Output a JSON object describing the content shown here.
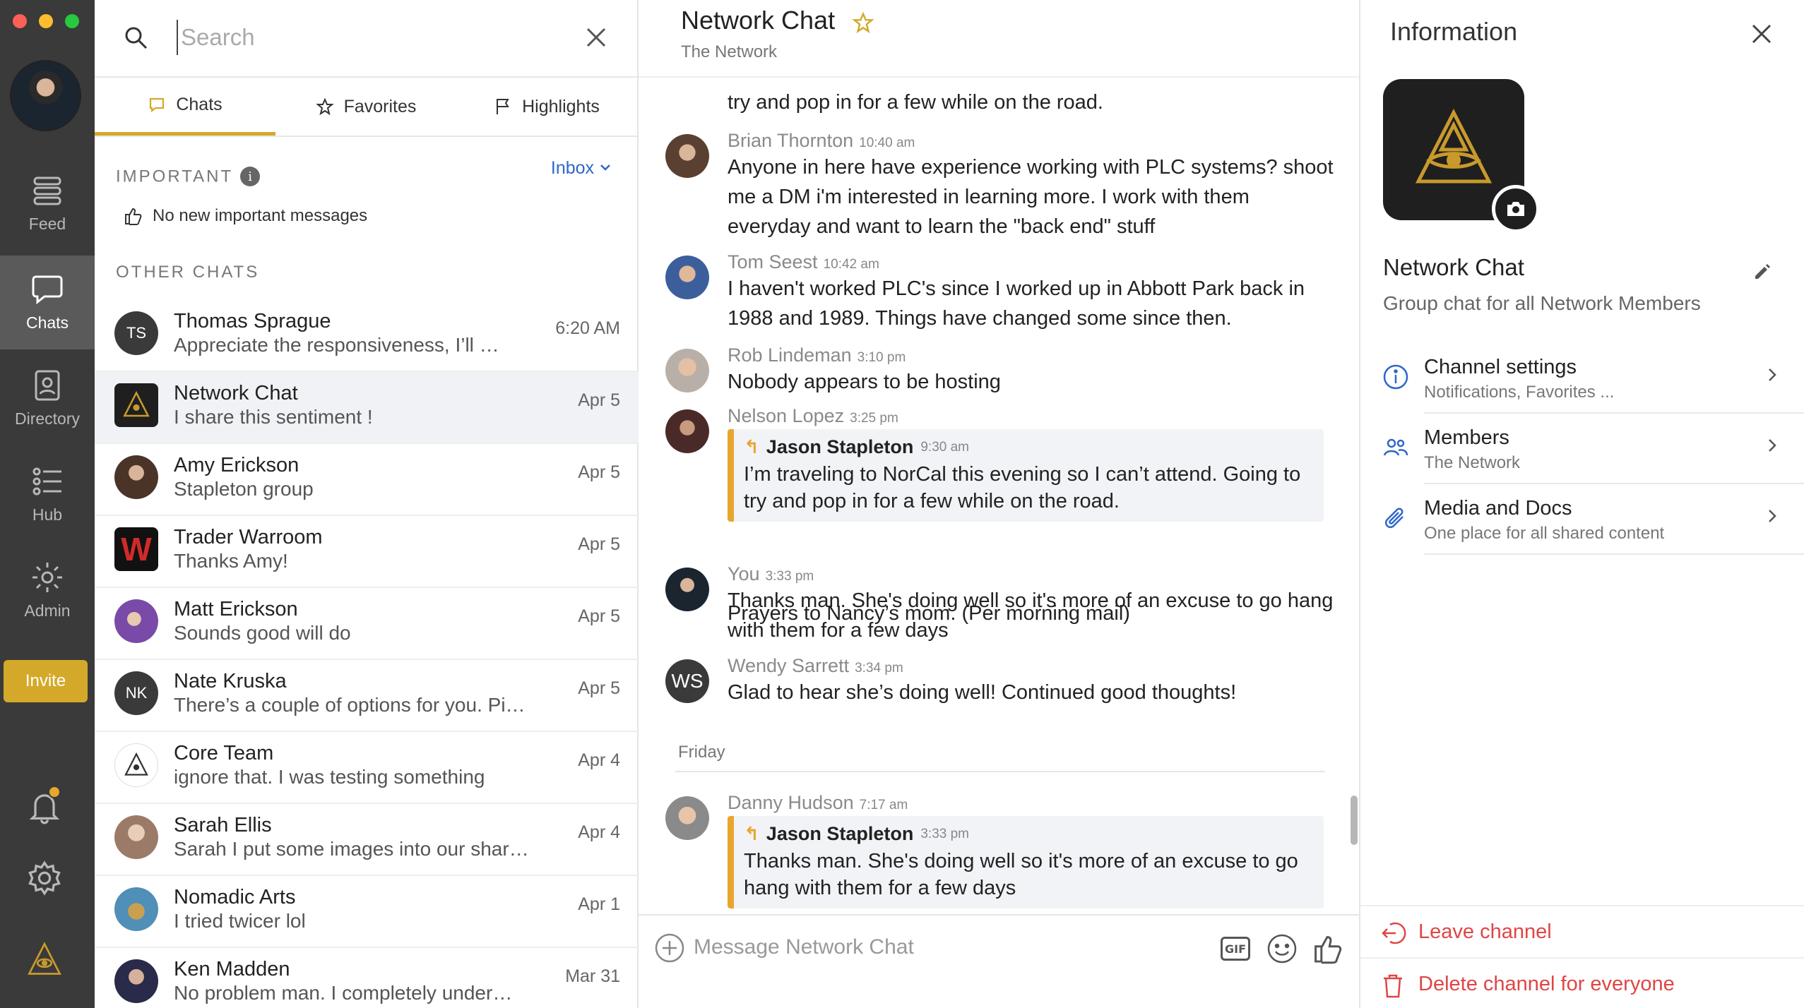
{
  "window": {
    "traffic_colors": [
      "#fe5f57",
      "#febc2e",
      "#28c840"
    ]
  },
  "rail": {
    "items": [
      {
        "label": "Feed",
        "icon": "feed-icon"
      },
      {
        "label": "Chats",
        "icon": "chat-bubble-icon"
      },
      {
        "label": "Directory",
        "icon": "directory-icon"
      },
      {
        "label": "Hub",
        "icon": "hub-list-icon"
      },
      {
        "label": "Admin",
        "icon": "admin-gear-icon"
      }
    ],
    "invite_label": "Invite",
    "accent": "#d4a92a"
  },
  "search": {
    "placeholder": "Search",
    "value": ""
  },
  "tabs": [
    {
      "label": "Chats",
      "icon": "chat-icon"
    },
    {
      "label": "Favorites",
      "icon": "star-icon"
    },
    {
      "label": "Highlights",
      "icon": "flag-icon"
    }
  ],
  "important": {
    "heading": "IMPORTANT",
    "info_glyph": "i",
    "filter": "Inbox",
    "empty_text": "No new important messages"
  },
  "other_heading": "OTHER CHATS",
  "chats": [
    {
      "name": "Thomas Sprague",
      "preview": "Appreciate the responsiveness, I’ll …",
      "time": "6:20 AM",
      "initials": "TS"
    },
    {
      "name": "Network Chat",
      "preview": "I share this sentiment !",
      "time": "Apr 5"
    },
    {
      "name": "Amy Erickson",
      "preview": "Stapleton group",
      "time": "Apr 5"
    },
    {
      "name": "Trader Warroom",
      "preview": "Thanks Amy!",
      "time": "Apr 5",
      "initials": "W"
    },
    {
      "name": "Matt Erickson",
      "preview": "Sounds good will do",
      "time": "Apr 5"
    },
    {
      "name": "Nate Kruska",
      "preview": "There’s a couple of options for you. Pi…",
      "time": "Apr 5",
      "initials": "NK"
    },
    {
      "name": "Core Team",
      "preview": "ignore that. I was testing something",
      "time": "Apr 4"
    },
    {
      "name": "Sarah Ellis",
      "preview": "Sarah I put some images into our shar…",
      "time": "Apr 4"
    },
    {
      "name": "Nomadic Arts",
      "preview": "I tried twicer lol",
      "time": "Apr 1"
    },
    {
      "name": "Ken Madden",
      "preview": "No problem man. I completely under…",
      "time": "Mar 31"
    }
  ],
  "conversation": {
    "title": "Network Chat",
    "subtitle": "The Network",
    "partial_top": "try and pop in for a few while on the road.",
    "messages": [
      {
        "author": "Brian Thornton",
        "time": "10:40 am",
        "text": "Anyone in here have experience working with PLC systems? shoot me a DM i'm interested in learning more. I work with them everyday and want to learn the \"back end\" stuff"
      },
      {
        "author": "Tom Seest",
        "time": "10:42 am",
        "text": "I haven't worked PLC's since I worked up in Abbott Park back in 1988 and 1989. Things have changed some since then."
      },
      {
        "author": "Rob Lindeman",
        "time": "3:10 pm",
        "text": "Nobody appears to be hosting"
      },
      {
        "author": "Nelson Lopez",
        "time": "3:25 pm",
        "quote_author": "Jason Stapleton",
        "quote_time": "9:30 am",
        "quote_text": "I’m traveling to NorCal this evening so I can’t attend. Going to try and pop in for a few while on the road.",
        "text": "Prayers to Nancy’s mom. (Per morning mail)"
      },
      {
        "author": "You",
        "time": "3:33 pm",
        "text": "Thanks man. She's doing well so it's more of an excuse to go hang with them for a few days"
      },
      {
        "author": "Wendy Sarrett",
        "time": "3:34 pm",
        "initials": "WS",
        "text": "Glad to hear she’s doing well! Continued good thoughts!"
      },
      {
        "author": "Danny Hudson",
        "time": "7:17 am",
        "quote_author": "Jason Stapleton",
        "quote_time": "3:33 pm",
        "quote_text": "Thanks man. She's doing well so it's more of an excuse to go hang with them for a few days"
      }
    ],
    "day_separator": "Friday",
    "composer_placeholder": "Message Network Chat",
    "gif_label": "GIF"
  },
  "info": {
    "title": "Information",
    "name": "Network Chat",
    "description": "Group chat for all Network Members",
    "rows": [
      {
        "title": "Channel settings",
        "subtitle": "Notifications, Favorites ...",
        "icon": "info-circle-icon"
      },
      {
        "title": "Members",
        "subtitle": "The Network",
        "icon": "members-icon"
      },
      {
        "title": "Media and Docs",
        "subtitle": "One place for all shared content",
        "icon": "paperclip-icon"
      }
    ],
    "leave_label": "Leave channel",
    "delete_label": "Delete channel for everyone",
    "danger_color": "#e04545",
    "link_color": "#2f67c9"
  }
}
